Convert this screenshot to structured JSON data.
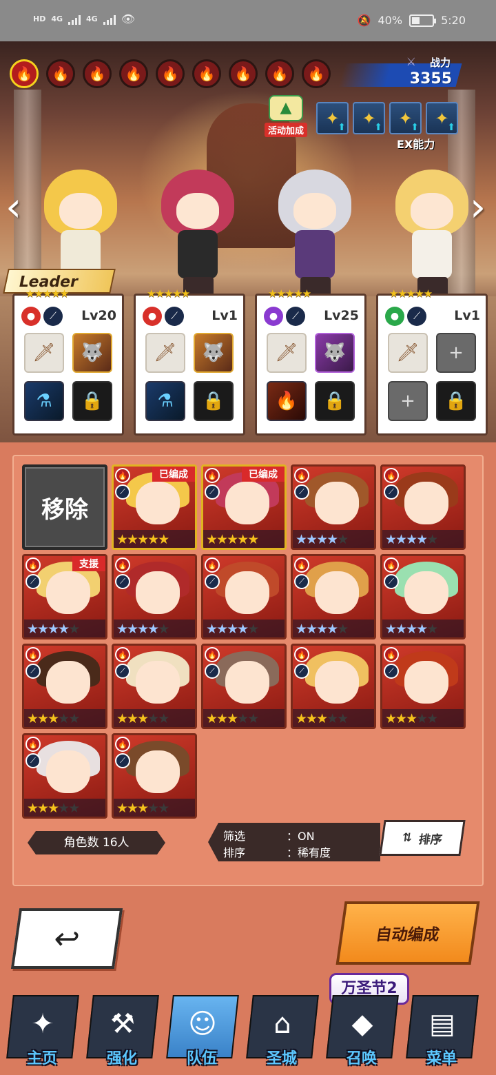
{
  "statusbar": {
    "hd": "HD",
    "net1": "4G",
    "net2": "4G",
    "battery_pct": "40%",
    "battery_level": 0.4,
    "time": "5:20"
  },
  "element_filters": [
    {
      "icon": "fire-element-icon",
      "selected": true
    },
    {
      "icon": "fire-element-icon",
      "selected": false
    },
    {
      "icon": "fire-element-icon",
      "selected": false
    },
    {
      "icon": "fire-element-icon",
      "selected": false
    },
    {
      "icon": "fire-element-icon",
      "selected": false
    },
    {
      "icon": "fire-element-icon",
      "selected": false
    },
    {
      "icon": "fire-element-icon",
      "selected": false
    },
    {
      "icon": "fire-element-icon",
      "selected": false
    },
    {
      "icon": "fire-element-icon",
      "selected": false
    }
  ],
  "power": {
    "label": "战力",
    "value": "3355"
  },
  "event_bonus": {
    "label": "活动加成"
  },
  "ex": {
    "label": "EX能力",
    "count": 4
  },
  "leader_label": "Leader",
  "party": [
    {
      "level": "Lv20",
      "stars": "★★★★★",
      "element_color": "#d8302a"
    },
    {
      "level": "Lv1",
      "stars": "★★★★★",
      "element_color": "#d8302a"
    },
    {
      "level": "Lv25",
      "stars": "★★★★★",
      "element_color": "#8a3ad0"
    },
    {
      "level": "Lv1",
      "stars": "★★★★★",
      "element_color": "#2aa84a"
    }
  ],
  "roster": {
    "remove_label": "移除",
    "tiles": [
      {
        "ribbon": "已编成",
        "stars": 5,
        "tier": "gold",
        "hair": "#f4c84a"
      },
      {
        "ribbon": "已编成",
        "stars": 5,
        "tier": "gold",
        "hair": "#c23a5a"
      },
      {
        "ribbon": "",
        "stars": 4,
        "tier": "blue",
        "hair": "#a0582a"
      },
      {
        "ribbon": "",
        "stars": 4,
        "tier": "blue",
        "hair": "#9a3a1a"
      },
      {
        "ribbon": "支援",
        "stars": 4,
        "tier": "blue",
        "hair": "#f2d070"
      },
      {
        "ribbon": "",
        "stars": 4,
        "tier": "blue",
        "hair": "#b02a2a"
      },
      {
        "ribbon": "",
        "stars": 4,
        "tier": "blue",
        "hair": "#c04a2a"
      },
      {
        "ribbon": "",
        "stars": 4,
        "tier": "blue",
        "hair": "#e0a04a"
      },
      {
        "ribbon": "",
        "stars": 4,
        "tier": "blue",
        "hair": "#9ae0b0"
      },
      {
        "ribbon": "",
        "stars": 3,
        "tier": "gold",
        "hair": "#4a2a1a"
      },
      {
        "ribbon": "",
        "stars": 3,
        "tier": "gold",
        "hair": "#f0e0c0"
      },
      {
        "ribbon": "",
        "stars": 3,
        "tier": "gold",
        "hair": "#8a6a5a"
      },
      {
        "ribbon": "",
        "stars": 3,
        "tier": "gold",
        "hair": "#f0c060"
      },
      {
        "ribbon": "",
        "stars": 3,
        "tier": "gold",
        "hair": "#c03a1a"
      },
      {
        "ribbon": "",
        "stars": 3,
        "tier": "gold",
        "hair": "#e8e0e0"
      },
      {
        "ribbon": "",
        "stars": 3,
        "tier": "gold",
        "hair": "#7a4a2a"
      }
    ]
  },
  "footer": {
    "count_label": "角色数 16人",
    "filter_key": "筛选",
    "filter_val": "：ON",
    "sort_key": "排序",
    "sort_val": "：稀有度",
    "sort_button": "排序"
  },
  "actions": {
    "auto_label": "自动编成"
  },
  "event_badge": "万圣节2",
  "nav": [
    {
      "label": "主页",
      "icon": "home-emblem-icon"
    },
    {
      "label": "强化",
      "icon": "hammer-icon"
    },
    {
      "label": "队伍",
      "icon": "team-portrait-icon"
    },
    {
      "label": "圣城",
      "icon": "castle-icon"
    },
    {
      "label": "召唤",
      "icon": "crystal-icon"
    },
    {
      "label": "菜单",
      "icon": "book-icon"
    }
  ]
}
